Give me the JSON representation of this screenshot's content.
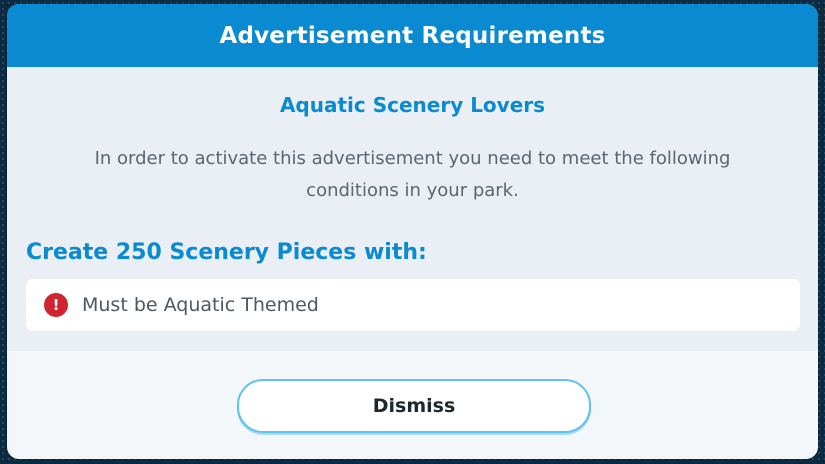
{
  "dialog": {
    "title": "Advertisement Requirements",
    "ad_name": "Aquatic Scenery Lovers",
    "description": "In order to activate this advertisement you need to meet the following conditions in your park.",
    "requirement_heading": "Create 250 Scenery Pieces with:",
    "conditions": [
      {
        "icon": "alert-icon",
        "glyph": "!",
        "text": "Must be Aquatic Themed",
        "status_color": "#d0242e"
      }
    ],
    "dismiss_label": "Dismiss"
  },
  "colors": {
    "header": "#0a8ad0",
    "accent_text": "#0a8ad0",
    "button_border": "#5fc1ee",
    "error": "#d0242e"
  }
}
